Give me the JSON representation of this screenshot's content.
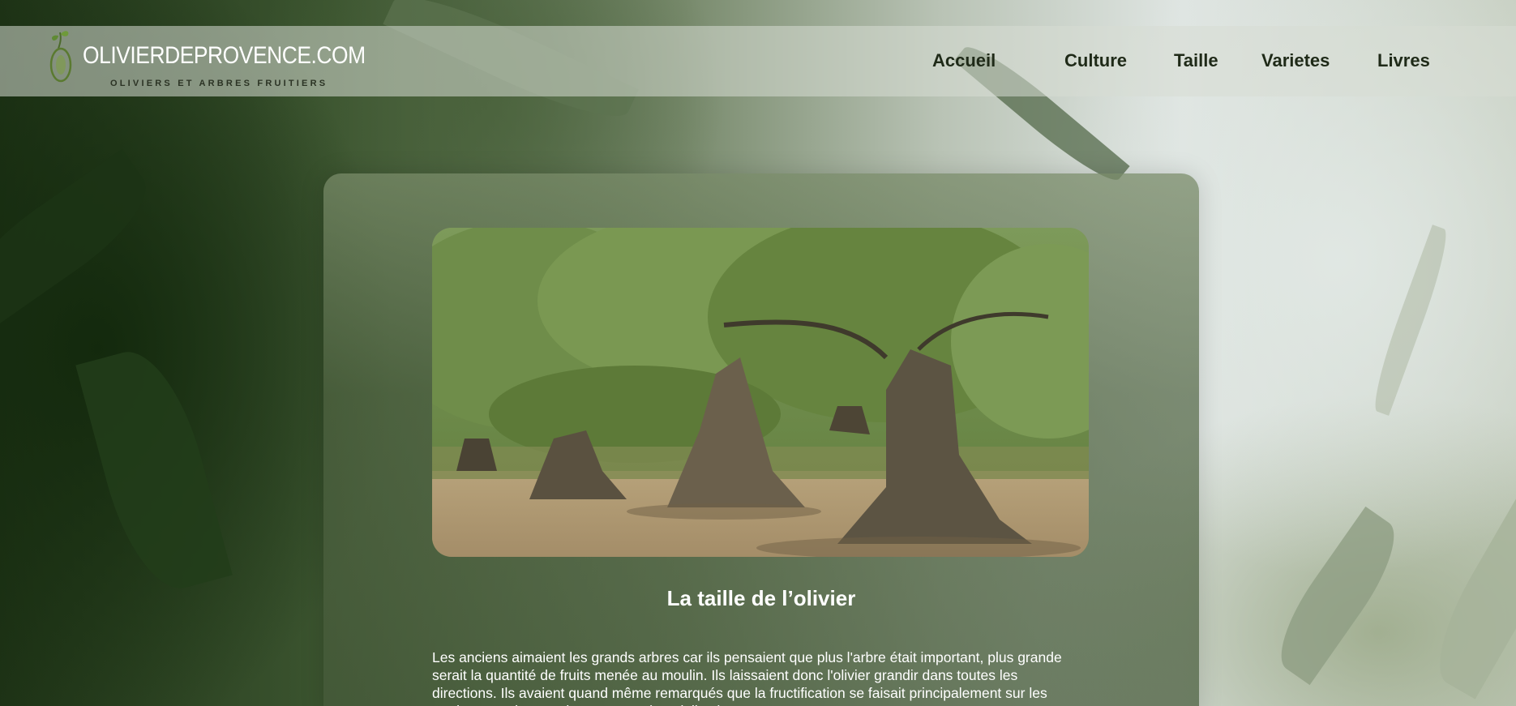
{
  "site": {
    "logo_title": "OLIVIERDEPROVENCE.COM",
    "logo_subtitle": "OLIVIERS ET ARBRES FRUITIERS",
    "logo_icon": "olive-branch-icon"
  },
  "nav": {
    "items": [
      {
        "label": "Accueil"
      },
      {
        "label": "Culture"
      },
      {
        "label": "Taille"
      },
      {
        "label": "Varietes"
      },
      {
        "label": "Livres"
      }
    ]
  },
  "article": {
    "image": "olive-grove-photo",
    "title": "La taille de l’olivier",
    "paragraph": "Les anciens aimaient les grands arbres car ils pensaient que plus l'arbre était important, plus grande serait la quantité de fruits menée au moulin. Ils laissaient donc l'olivier grandir dans toutes les directions. Ils avaient quand même remarqués que la fructification se faisait principalement sur les parties retombantes des rameaux (penduliers)."
  },
  "colors": {
    "header_bg": "#d7dcd4",
    "nav_text": "#1f2a18",
    "card_bg": "#5f7350",
    "text": "#ffffff"
  }
}
